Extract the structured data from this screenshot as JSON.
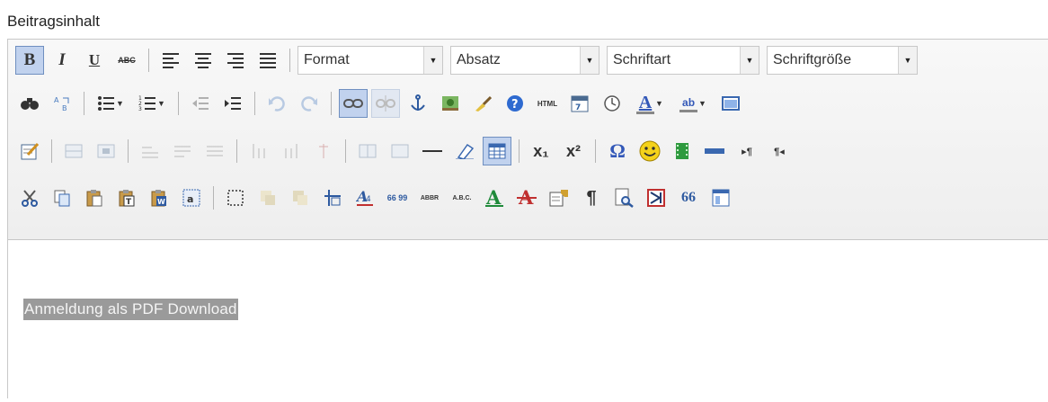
{
  "field_label": "Beitragsinhalt",
  "dropdowns": {
    "format": "Format",
    "paragraph": "Absatz",
    "font": "Schriftart",
    "size": "Schriftgröße"
  },
  "toolbar_text": {
    "bold": "B",
    "italic": "I",
    "underline": "U",
    "strike": "ABC",
    "html": "HTML",
    "subscript": "x₁",
    "superscript": "x²",
    "omega": "Ω",
    "abbr": "ABBR",
    "acronym": "A.B.C.",
    "quote": "66 99",
    "blockquote": "66",
    "pilcrow": "¶",
    "ltr": "▸¶",
    "rtl": "¶◂",
    "font_color": "A",
    "bg_color": "ab"
  },
  "content": {
    "selected_text": "Anmeldung als PDF Download"
  },
  "colors": {
    "selection_bg": "#9a9a9a",
    "active_button_bg": "#c1d2ee",
    "toolbar_bg": "#eeeeee"
  }
}
